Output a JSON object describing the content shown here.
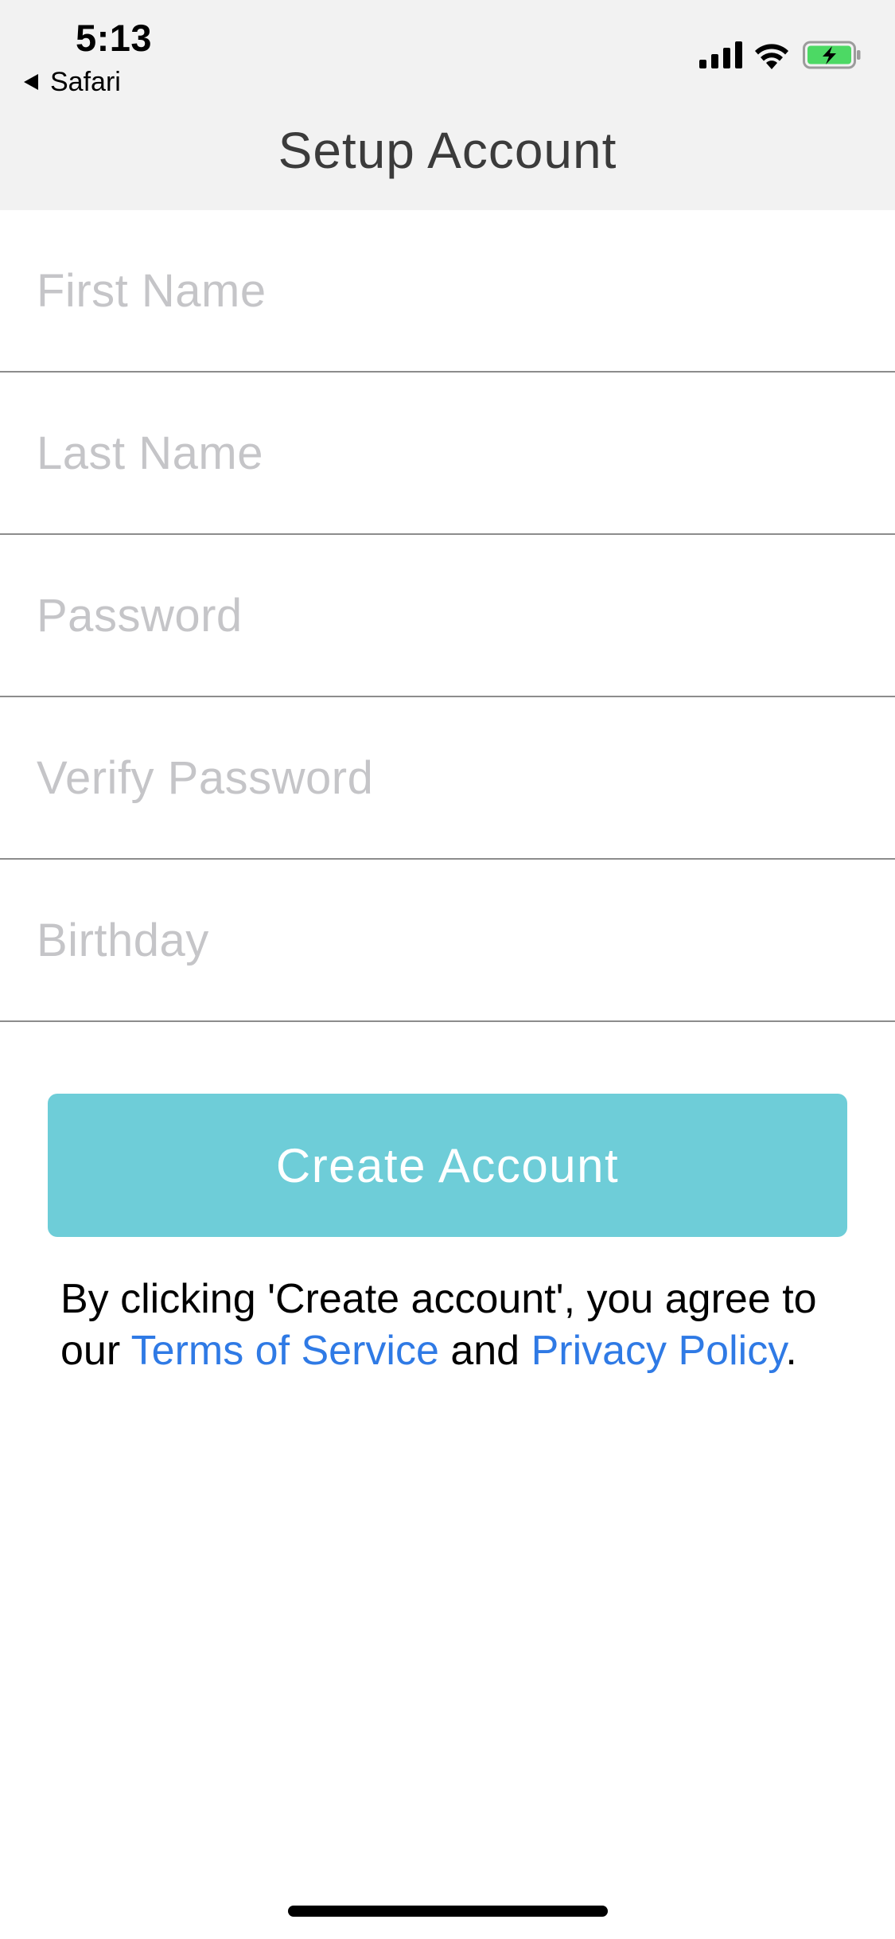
{
  "status_bar": {
    "time": "5:13",
    "back_app_label": "Safari",
    "icons": [
      "cellular-signal-icon",
      "wifi-icon",
      "battery-charging-icon"
    ],
    "battery_color": "#4cd964"
  },
  "nav": {
    "title": "Setup Account"
  },
  "form": {
    "fields": [
      {
        "placeholder": "First Name",
        "value": ""
      },
      {
        "placeholder": "Last Name",
        "value": ""
      },
      {
        "placeholder": "Password",
        "value": ""
      },
      {
        "placeholder": "Verify Password",
        "value": ""
      },
      {
        "placeholder": "Birthday",
        "value": ""
      }
    ],
    "submit_label": "Create Account",
    "button_color": "#6ecdd8"
  },
  "legal": {
    "prefix": "By clicking 'Create account', you agree to our",
    "terms_link": "Terms of Service",
    "joiner": "and",
    "privacy_link": "Privacy Policy",
    "suffix": ".",
    "link_color": "#2f7ae5"
  }
}
